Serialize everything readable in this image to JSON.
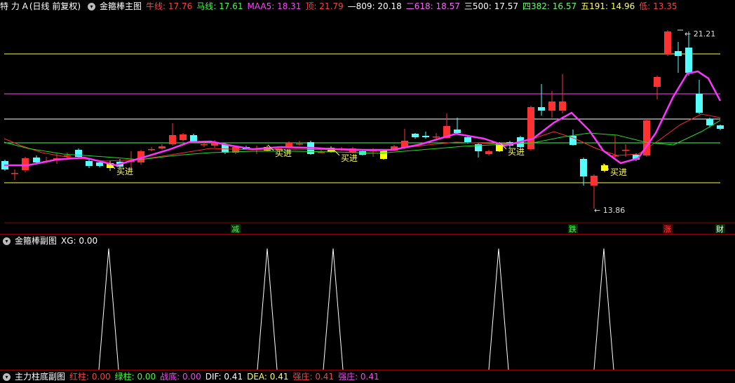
{
  "main_header": {
    "stock": "特 力 A",
    "period": "(日线 前复权)",
    "indicator": "金箍棒主图",
    "values": [
      {
        "label": "牛线: ",
        "value": "17.76",
        "color": "#ff4040"
      },
      {
        "label": "马线: ",
        "value": "17.61",
        "color": "#40ff40"
      },
      {
        "label": "MAA5: ",
        "value": "18.31",
        "color": "#ff40ff"
      },
      {
        "label": "顶: ",
        "value": "21.79",
        "color": "#ff4040"
      },
      {
        "label": "—809: ",
        "value": "20.18",
        "color": "#ffffff"
      },
      {
        "label": "二618: ",
        "value": "18.57",
        "color": "#ff60ff"
      },
      {
        "label": "三500: ",
        "value": "17.57",
        "color": "#ffffff"
      },
      {
        "label": "四382: ",
        "value": "16.57",
        "color": "#60ff60"
      },
      {
        "label": "五191: ",
        "value": "14.96",
        "color": "#ffff60"
      },
      {
        "label": "低: ",
        "value": "13.35",
        "color": "#ff4040"
      }
    ]
  },
  "sub1_header": {
    "indicator": "金箍棒副图",
    "label": "XG: ",
    "value": "0.00"
  },
  "sub2_header": {
    "indicator": "主力柱底副图",
    "values": [
      {
        "label": "红柱: ",
        "value": "0.00",
        "color": "#ff4040"
      },
      {
        "label": "绿柱: ",
        "value": "0.00",
        "color": "#40ff40"
      },
      {
        "label": "战底: ",
        "value": "0.00",
        "color": "#ff40ff"
      },
      {
        "label": "DIF: ",
        "value": "0.41",
        "color": "#ffffff"
      },
      {
        "label": "DEA: ",
        "value": "0.41",
        "color": "#ffff60"
      },
      {
        "label": "强庄: ",
        "value": "0.41",
        "color": "#ff4040"
      },
      {
        "label": "强庄: ",
        "value": "0.41",
        "color": "#ff40ff"
      }
    ]
  },
  "annotations": {
    "high_label": "21.21",
    "low_label": "13.86",
    "buy_label": "买进"
  },
  "event_markers": [
    {
      "text": "减",
      "color": "#40ff40"
    },
    {
      "text": "跌",
      "color": "#40ff40"
    },
    {
      "text": "涨",
      "color": "#ff4040"
    },
    {
      "text": "财",
      "color": "#ffffff"
    }
  ],
  "colors": {
    "up": "#ff3232",
    "down": "#54ffff",
    "doji": "#ffff00",
    "ma_red": "#ff2a2a",
    "ma_green": "#22dd22",
    "ma_magenta": "#ff33ff",
    "level_yellow": "#ffff40",
    "level_magenta": "#ff40ff",
    "level_white": "#ffffff",
    "level_green": "#40ff40"
  }
}
